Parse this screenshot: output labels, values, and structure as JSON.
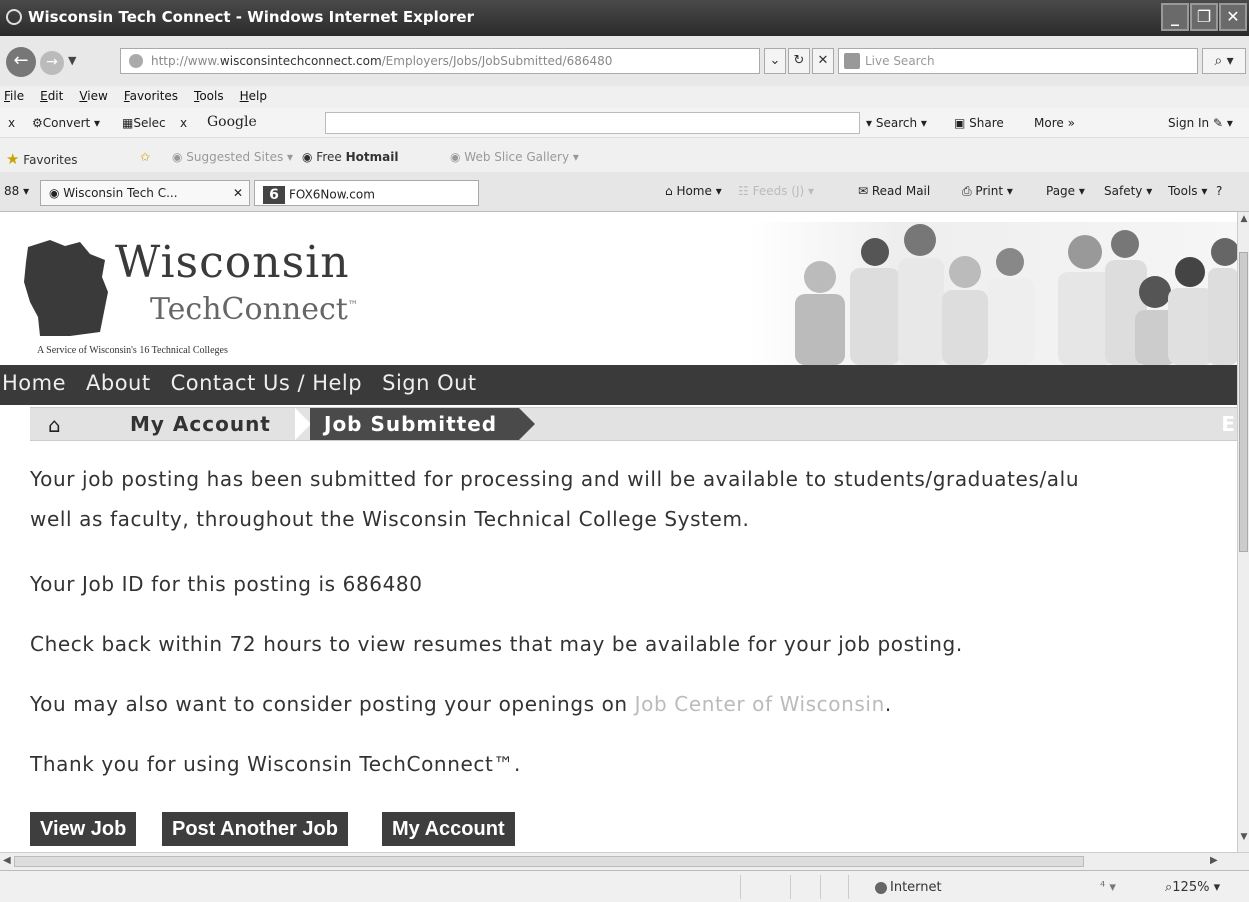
{
  "window": {
    "title": "Wisconsin Tech Connect - Windows Internet Explorer",
    "buttons": [
      "_",
      "❐",
      "✕"
    ]
  },
  "address": {
    "url_prefix": "http://www.",
    "url_domain": "wisconsintechconnect.com",
    "url_path": "/Employers/Jobs/JobSubmitted/686480",
    "search_placeholder": "Live Search"
  },
  "menu": [
    "File",
    "Edit",
    "View",
    "Favorites",
    "Tools",
    "Help"
  ],
  "google_toolbar": {
    "close": "x",
    "convert": "Convert",
    "select": "Selec",
    "x2": "x",
    "google": "Google",
    "search": "Search",
    "share": "Share",
    "more": "More »",
    "signin": "Sign In"
  },
  "favorites_bar": {
    "favorites": "Favorites",
    "suggested": "Suggested Sites ▾",
    "hotmail_prefix": "Free ",
    "hotmail": "Hotmail",
    "gallery": "Web Slice Gallery ▾"
  },
  "tabs": {
    "quick": "88 ▾",
    "tab1": "Wisconsin Tech C...",
    "tab1_close": "✕",
    "tab2": "FOX6Now.com",
    "fox_logo": "6"
  },
  "commands": {
    "home": "Home",
    "feeds": "Feeds (J)",
    "read_mail": "Read Mail",
    "print": "Print",
    "page": "Page",
    "safety": "Safety",
    "tools": "Tools",
    "help": "Help"
  },
  "site": {
    "logo_line1": "Wisconsin",
    "logo_line2": "TechConnect",
    "logo_tm": "™",
    "tagline": "A Service of Wisconsin's 16 Technical Colleges",
    "nav": [
      "Home",
      "About",
      "Contact Us / Help",
      "Sign Out"
    ]
  },
  "breadcrumb": {
    "account": "My Account",
    "current": "Job Submitted",
    "end": "E"
  },
  "content": {
    "p1_line1": "Your job posting has been submitted for processing and will be available to students/graduates/alu",
    "p1_line2": "well as faculty, throughout the Wisconsin Technical College System.",
    "p2": "Your Job ID for this posting is 686480",
    "p3": "Check back within 72 hours to view resumes that may be available for your job posting.",
    "p4_prefix": "You may also want to consider posting your openings on ",
    "p4_link": "Job Center of Wisconsin",
    "p4_suffix": ".",
    "p5": "Thank you for using Wisconsin TechConnect™."
  },
  "buttons": {
    "view_job": "View Job",
    "post_another": "Post Another Job",
    "my_account": "My Account"
  },
  "status": {
    "zone": "Internet",
    "protected": "⁴ ▾",
    "zoom": "125%"
  }
}
